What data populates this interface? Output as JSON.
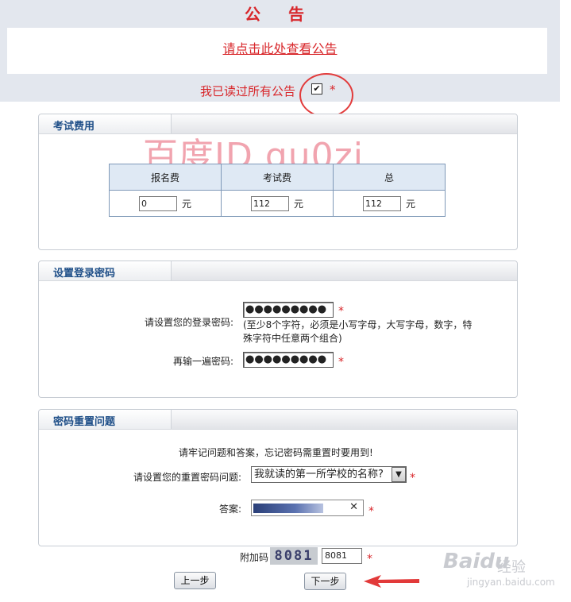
{
  "announcement": {
    "title": "公 告",
    "link_text": "请点击此处查看公告",
    "read_label": "我已读过所有公告",
    "read_checked": true,
    "required_mark": "*"
  },
  "watermark": {
    "text": "百度ID gu0zi"
  },
  "fee_section": {
    "title": "考试费用",
    "headers": [
      "报名费",
      "考试费",
      "总"
    ],
    "values": [
      "0",
      "112",
      "112"
    ],
    "unit": "元"
  },
  "password_section": {
    "title": "设置登录密码",
    "password_label": "请设置您的登录密码:",
    "password_value": "●●●●●●●●●",
    "hint_line1": "(至少8个字符，必须是小写字母，大写字母，数字，特",
    "hint_line2": "殊字符中任意两个组合)",
    "confirm_label": "再输一遍密码:",
    "confirm_value": "●●●●●●●●●",
    "required_mark": "*"
  },
  "security_section": {
    "title": "密码重置问题",
    "notice": "请牢记问题和答案，忘记密码需重置时要用到!",
    "question_label": "请设置您的重置密码问题:",
    "question_selected": "我就读的第一所学校的名称?",
    "answer_label": "答案:",
    "clear_glyph": "✕",
    "required_mark": "*"
  },
  "captcha": {
    "label": "附加码",
    "image_text": "8081",
    "input_value": "8081",
    "required_mark": "*"
  },
  "buttons": {
    "prev": "上一步",
    "next": "下一步"
  },
  "baidu_watermark": {
    "logo": "Baidu",
    "jingyan": "经验",
    "url": "jingyan.baidu.com"
  },
  "colors": {
    "accent_red": "#d8262a",
    "header_blue": "#1f4f88",
    "table_header_bg": "#dfe9f4",
    "band_bg": "#e3e7ee"
  }
}
